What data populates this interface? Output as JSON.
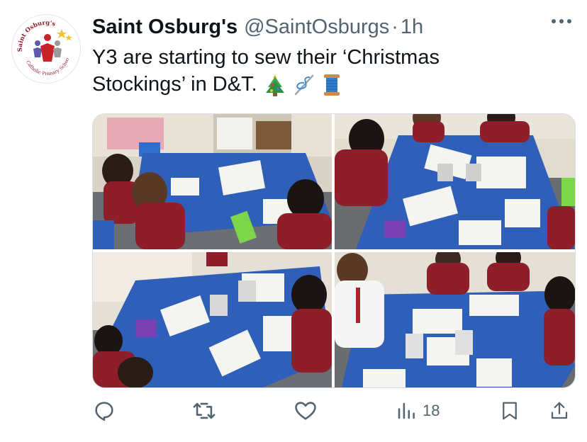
{
  "tweet": {
    "display_name": "Saint Osburg's",
    "handle": "@SaintOsburgs",
    "separator": "·",
    "time": "1h",
    "text_line1": "Y3 are starting to sew their ‘Christmas",
    "text_line2": "Stockings’ in D&T.",
    "emojis": [
      "christmas-tree-icon",
      "needle-thread-icon",
      "spool-icon"
    ]
  },
  "avatar": {
    "ring_text_top": "Saint Osburg's",
    "ring_text_bottom": "Catholic Primary School",
    "icon": "school-logo-icon"
  },
  "media": {
    "photos": [
      {
        "name": "classroom-photo-1",
        "description_icon": "photo"
      },
      {
        "name": "classroom-photo-2",
        "description_icon": "photo"
      },
      {
        "name": "classroom-photo-3",
        "description_icon": "photo"
      },
      {
        "name": "classroom-photo-4",
        "description_icon": "photo"
      }
    ]
  },
  "actions": {
    "reply_icon": "reply-icon",
    "retweet_icon": "retweet-icon",
    "like_icon": "heart-icon",
    "views_icon": "views-icon",
    "views_count": "18",
    "bookmark_icon": "bookmark-icon",
    "share_icon": "share-icon"
  },
  "colors": {
    "text": "#0f1419",
    "secondary": "#536471",
    "table_blue": "#2f5fb8",
    "uniform_red": "#8e1f2a"
  }
}
